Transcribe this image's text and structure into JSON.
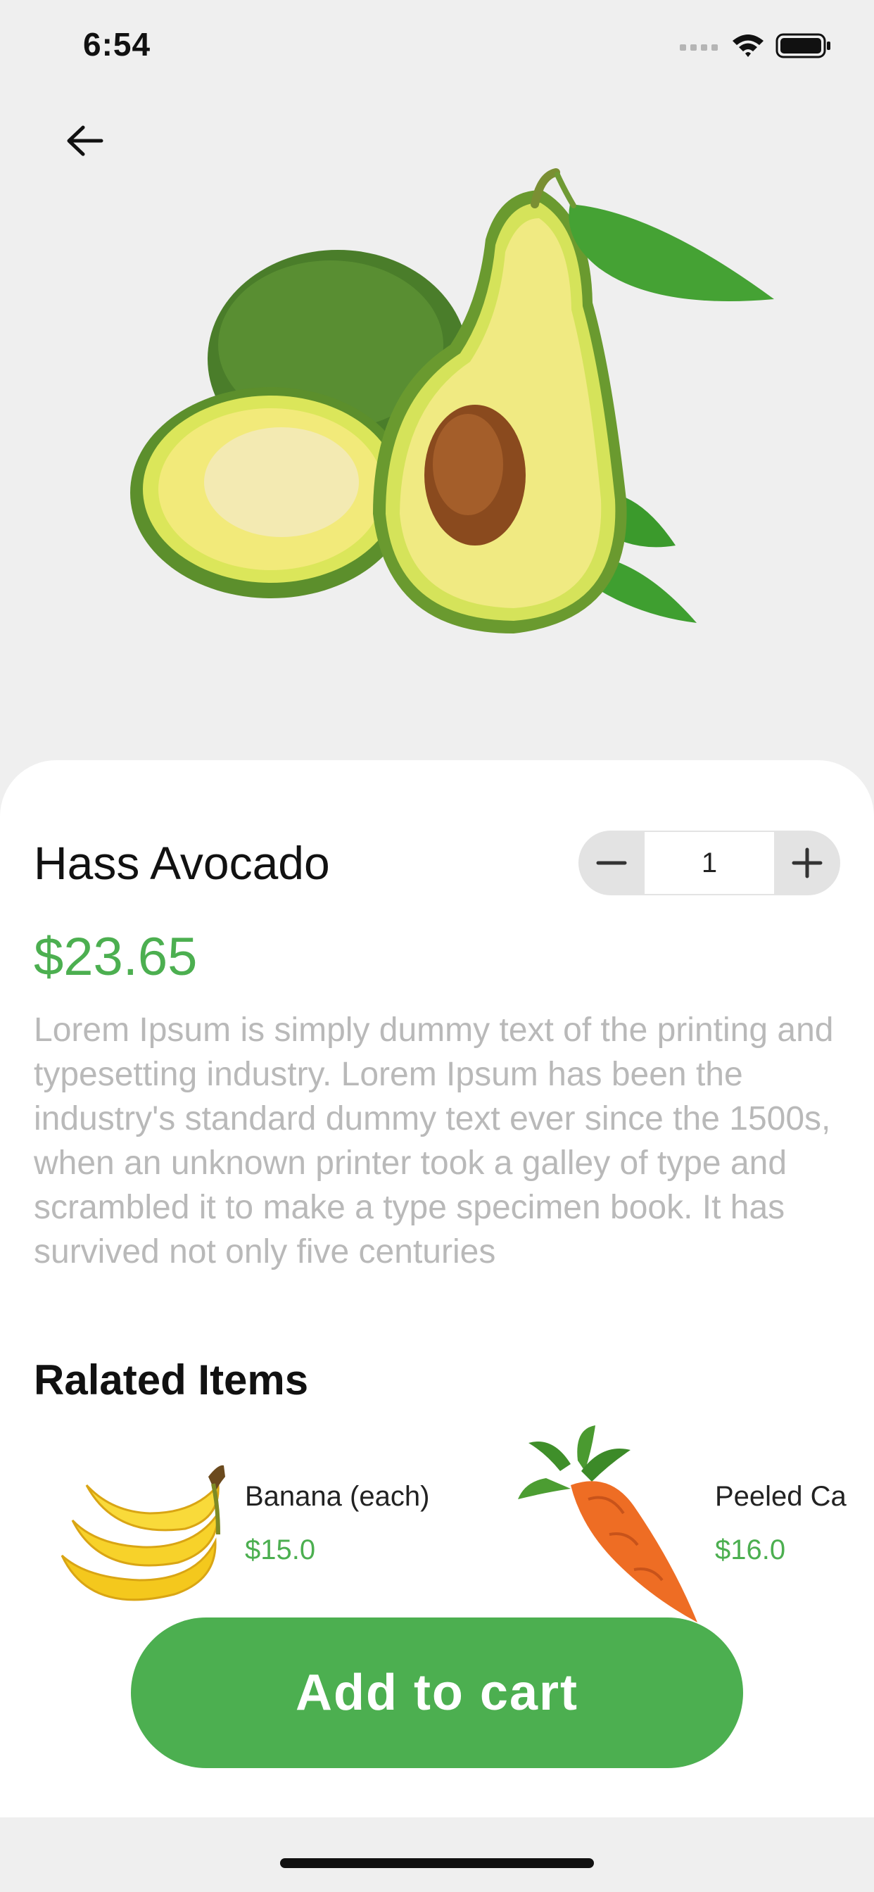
{
  "status": {
    "time": "6:54"
  },
  "colors": {
    "accent": "#4caf50",
    "muted_text": "#b9b9b9",
    "background": "#efefef"
  },
  "icons": {
    "back": "arrow-left-icon",
    "minus": "minus-icon",
    "plus": "plus-icon",
    "signal": "signal-icon",
    "wifi": "wifi-icon",
    "battery": "battery-icon"
  },
  "product": {
    "name": "Hass Avocado",
    "price": "$23.65",
    "quantity": "1",
    "description": "Lorem Ipsum is simply dummy text of the printing and typesetting industry. Lorem Ipsum has been the industry's standard dummy text ever since the 1500s, when an unknown printer took a galley of type and scrambled it to make a type specimen book. It has survived not only five centuries"
  },
  "related": {
    "title": "Ralated Items",
    "items": [
      {
        "name": "Banana (each)",
        "price": "$15.0"
      },
      {
        "name": "Peeled Ca",
        "price": "$16.0"
      }
    ]
  },
  "cart": {
    "label": "Add to cart"
  }
}
